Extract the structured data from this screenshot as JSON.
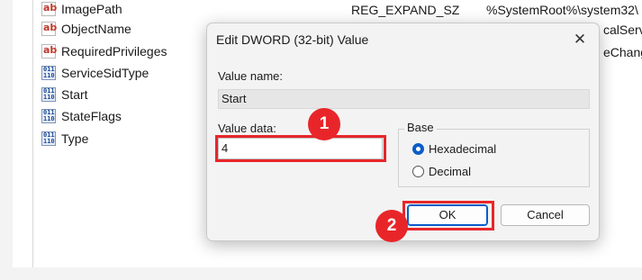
{
  "registry_rows": [
    {
      "icon": "string-value-icon",
      "icon_text": "ab",
      "name": "ImagePath",
      "type": "REG_EXPAND_SZ",
      "data": "%SystemRoot%\\system32\\"
    },
    {
      "icon": "string-value-icon",
      "icon_text": "ab",
      "name": "ObjectName",
      "data_fragment": "calServ"
    },
    {
      "icon": "string-value-icon",
      "icon_text": "ab",
      "name": "RequiredPrivileges",
      "data_fragment": "eChang"
    },
    {
      "icon": "binary-value-icon",
      "icon_text": "011\n110",
      "name": "ServiceSidType"
    },
    {
      "icon": "binary-value-icon",
      "icon_text": "011\n110",
      "name": "Start"
    },
    {
      "icon": "binary-value-icon",
      "icon_text": "011\n110",
      "name": "StateFlags"
    },
    {
      "icon": "binary-value-icon",
      "icon_text": "011\n110",
      "name": "Type"
    }
  ],
  "dialog": {
    "title": "Edit DWORD (32-bit) Value",
    "close_glyph": "✕",
    "value_name_label": "Value name:",
    "value_name": "Start",
    "value_data_label": "Value data:",
    "value_data": "4",
    "base_label": "Base",
    "base_options": [
      {
        "label": "Hexadecimal",
        "selected": true
      },
      {
        "label": "Decimal",
        "selected": false
      }
    ],
    "ok_label": "OK",
    "cancel_label": "Cancel"
  },
  "annotations": {
    "step1": "1",
    "step2": "2",
    "highlight_color": "#e8262a"
  },
  "colors": {
    "accent": "#0b5cc8",
    "dialog_bg": "#f3f3f3"
  }
}
